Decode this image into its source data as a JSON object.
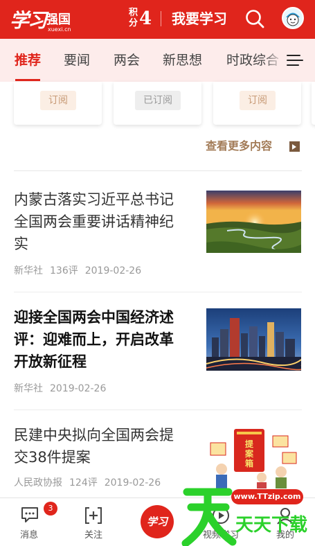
{
  "header": {
    "logo_main": "学习",
    "logo_sub": "强国",
    "logo_url": "xuexi.cn",
    "points_label": "积分",
    "points_value": "4",
    "study_button": "我要学习",
    "search_icon": "search-icon",
    "avatar_icon": "avatar-icon",
    "brand_color": "#e0251c"
  },
  "tabs": [
    {
      "label": "推荐",
      "active": true
    },
    {
      "label": "要闻",
      "active": false
    },
    {
      "label": "两会",
      "active": false
    },
    {
      "label": "新思想",
      "active": false
    },
    {
      "label": "时政综合",
      "active": false
    }
  ],
  "subscriptions": [
    {
      "label": "订阅",
      "subscribed": false
    },
    {
      "label": "已订阅",
      "subscribed": true
    },
    {
      "label": "订阅",
      "subscribed": false
    }
  ],
  "more_link": "查看更多内容",
  "articles": [
    {
      "title": "内蒙古落实习近平总书记全国两会重要讲话精神纪实",
      "source": "新华社",
      "comments": "136评",
      "date": "2019-02-26",
      "image": "grassland-sunset"
    },
    {
      "title": "迎接全国两会中国经济述评：迎难而上，开启改革开放新征程",
      "source": "新华社",
      "comments": "",
      "date": "2019-02-26",
      "image": "city-night-skyline"
    },
    {
      "title": "民建中央拟向全国两会提交38件提案",
      "source": "人民政协报",
      "comments": "124评",
      "date": "2019-02-26",
      "image": "proposal-box-cartoon",
      "image_text": [
        "提",
        "案",
        "箱"
      ]
    }
  ],
  "bottom_nav": [
    {
      "label": "消息",
      "icon": "message-icon",
      "badge": "3"
    },
    {
      "label": "关注",
      "icon": "follow-icon"
    },
    {
      "label": "学习",
      "icon": "xuexi-center-icon"
    },
    {
      "label": "视频学习",
      "icon": "video-icon"
    },
    {
      "label": "我的",
      "icon": "profile-icon"
    }
  ],
  "watermark": {
    "url": "www.TTzip.com",
    "text": "天天下载"
  }
}
